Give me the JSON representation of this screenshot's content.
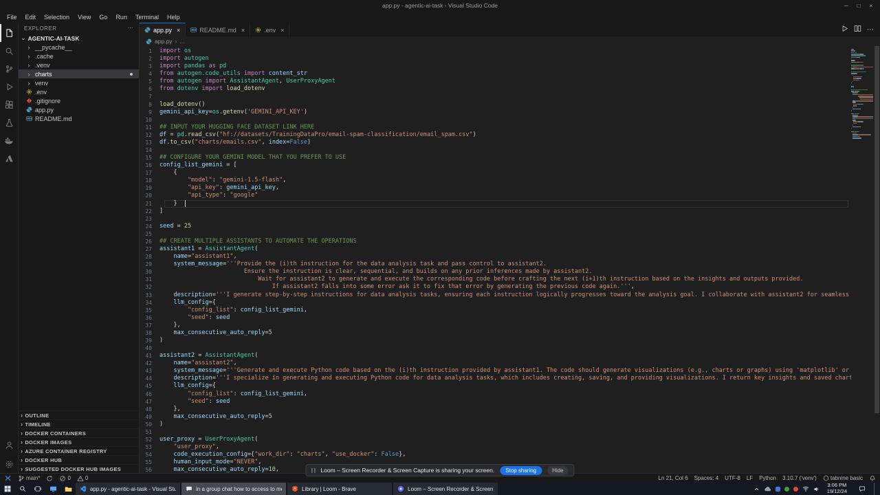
{
  "window": {
    "title": "app.py - agentic-ai-task - Visual Studio Code",
    "controls": [
      {
        "name": "minimize-button",
        "icon": "minimize-icon"
      },
      {
        "name": "maximize-button",
        "icon": "maximize-icon"
      },
      {
        "name": "close-button",
        "icon": "close-icon"
      }
    ]
  },
  "menubar": {
    "items": [
      "File",
      "Edit",
      "Selection",
      "View",
      "Go",
      "Run",
      "Terminal",
      "Help"
    ]
  },
  "activity_bar": {
    "top": [
      {
        "icon": "explorer-icon",
        "active": true
      },
      {
        "icon": "search-icon",
        "active": false
      },
      {
        "icon": "source-control-icon",
        "active": false
      },
      {
        "icon": "run-debug-icon",
        "active": false
      },
      {
        "icon": "extensions-icon",
        "active": false
      },
      {
        "icon": "testing-icon",
        "active": false
      },
      {
        "icon": "docker-icon",
        "active": false
      },
      {
        "icon": "azure-icon",
        "active": false
      }
    ],
    "bottom": [
      {
        "icon": "account-icon",
        "active": false
      },
      {
        "icon": "settings-icon",
        "active": false
      }
    ]
  },
  "explorer": {
    "header": "EXPLORER",
    "root": "AGENTIC-AI-TASK",
    "files": [
      {
        "label": "__pycache__",
        "kind": "folder"
      },
      {
        "label": ".cache",
        "kind": "folder"
      },
      {
        "label": ".venv",
        "kind": "folder"
      },
      {
        "label": "charts",
        "kind": "folder",
        "selected": true,
        "badge": true
      },
      {
        "label": "venv",
        "kind": "folder"
      },
      {
        "label": ".env",
        "kind": "file",
        "icon": "gear-file-icon"
      },
      {
        "label": ".gitignore",
        "kind": "file",
        "icon": "git-file-icon"
      },
      {
        "label": "app.py",
        "kind": "file",
        "icon": "python-file-icon"
      },
      {
        "label": "README.md",
        "kind": "file",
        "icon": "markdown-file-icon"
      }
    ],
    "sections": [
      "OUTLINE",
      "TIMELINE",
      "DOCKER CONTAINERS",
      "DOCKER IMAGES",
      "AZURE CONTAINER REGISTRY",
      "DOCKER HUB",
      "SUGGESTED DOCKER HUB IMAGES"
    ]
  },
  "editor_tabs": [
    {
      "label": "app.py",
      "icon": "python-file-icon",
      "active": true
    },
    {
      "label": "README.md",
      "icon": "markdown-file-icon",
      "active": false
    },
    {
      "label": ".env",
      "icon": "gear-file-icon",
      "active": false
    }
  ],
  "editor_actions": [
    {
      "icon": "run-icon"
    },
    {
      "icon": "split-editor-icon"
    },
    {
      "icon": "more-actions-icon"
    }
  ],
  "breadcrumb": {
    "file": "app.py",
    "symbol": "..."
  },
  "editor": {
    "cursor": {
      "line": 21,
      "col": 6
    },
    "lines": [
      [
        [
          "kw",
          "import"
        ],
        [
          "cls",
          " os"
        ]
      ],
      [
        [
          "kw",
          "import"
        ],
        [
          "cls",
          " autogen"
        ]
      ],
      [
        [
          "kw",
          "import"
        ],
        [
          "cls",
          " pandas"
        ],
        [
          "kw",
          " as"
        ],
        [
          "cls",
          " pd"
        ]
      ],
      [
        [
          "kw",
          "from"
        ],
        [
          "cls",
          " autogen.code_utils"
        ],
        [
          "kw",
          " import"
        ],
        [
          "var",
          " content_str"
        ]
      ],
      [
        [
          "kw",
          "from"
        ],
        [
          "cls",
          " autogen"
        ],
        [
          "kw",
          " import"
        ],
        [
          "cls",
          " AssistantAgent"
        ],
        [
          "txt",
          ","
        ],
        [
          "cls",
          " UserProxyAgent"
        ]
      ],
      [
        [
          "kw",
          "from"
        ],
        [
          "cls",
          " dotenv"
        ],
        [
          "kw",
          " import"
        ],
        [
          "fn",
          " load_dotenv"
        ]
      ],
      [],
      [
        [
          "fn",
          "load_dotenv"
        ],
        [
          "txt",
          "()"
        ]
      ],
      [
        [
          "var",
          "gemini_api_key"
        ],
        [
          "txt",
          "="
        ],
        [
          "cls",
          "os"
        ],
        [
          "txt",
          "."
        ],
        [
          "fn",
          "getenv"
        ],
        [
          "txt",
          "("
        ],
        [
          "str",
          "'GEMINI_API_KEY'"
        ],
        [
          "txt",
          ")"
        ]
      ],
      [],
      [
        [
          "com",
          "## INPUT YOUR HUGGING FACE DATASET LINK HERE"
        ]
      ],
      [
        [
          "var",
          "df"
        ],
        [
          "txt",
          " = "
        ],
        [
          "cls",
          "pd"
        ],
        [
          "txt",
          "."
        ],
        [
          "fn",
          "read_csv"
        ],
        [
          "txt",
          "("
        ],
        [
          "str",
          "\"hf://datasets/TrainingDataPro/email-spam-classification/email_spam.csv\""
        ],
        [
          "txt",
          ")"
        ]
      ],
      [
        [
          "var",
          "df"
        ],
        [
          "txt",
          "."
        ],
        [
          "fn",
          "to_csv"
        ],
        [
          "txt",
          "("
        ],
        [
          "str",
          "\"charts/emails.csv\""
        ],
        [
          "txt",
          ", "
        ],
        [
          "prm",
          "index"
        ],
        [
          "txt",
          "="
        ],
        [
          "const",
          "False"
        ],
        [
          "txt",
          ")"
        ]
      ],
      [],
      [
        [
          "com",
          "## CONFIGURE YOUR GEMINI MODEL THAT YOU PREFER TO USE"
        ]
      ],
      [
        [
          "var",
          "config_list_gemini"
        ],
        [
          "txt",
          " = ["
        ]
      ],
      [
        [
          "txt",
          "    {"
        ]
      ],
      [
        [
          "str",
          "        \"model\""
        ],
        [
          "txt",
          ": "
        ],
        [
          "str",
          "\"gemini-1.5-flash\""
        ],
        [
          "txt",
          ","
        ]
      ],
      [
        [
          "str",
          "        \"api_key\""
        ],
        [
          "txt",
          ": "
        ],
        [
          "var",
          "gemini_api_key"
        ],
        [
          "txt",
          ","
        ]
      ],
      [
        [
          "str",
          "        \"api_type\""
        ],
        [
          "txt",
          ": "
        ],
        [
          "str",
          "\"google\""
        ]
      ],
      [
        [
          "txt",
          "    }"
        ]
      ],
      [
        [
          "txt",
          "]"
        ]
      ],
      [],
      [
        [
          "var",
          "seed"
        ],
        [
          "txt",
          " = "
        ],
        [
          "num",
          "25"
        ]
      ],
      [],
      [
        [
          "com",
          "## CREATE MULTIPLE ASSISTANTS TO AUTOMATE THE OPERATIONS"
        ]
      ],
      [
        [
          "var",
          "assistant1"
        ],
        [
          "txt",
          " = "
        ],
        [
          "cls",
          "AssistantAgent"
        ],
        [
          "txt",
          "("
        ]
      ],
      [
        [
          "prm",
          "    name"
        ],
        [
          "txt",
          "="
        ],
        [
          "str",
          "\"assistant1\""
        ],
        [
          "txt",
          ","
        ]
      ],
      [
        [
          "prm",
          "    system_message"
        ],
        [
          "txt",
          "="
        ],
        [
          "str",
          "'''Provide the (i)th instruction for the data analysis task and pass control to assistant2."
        ]
      ],
      [
        [
          "str",
          "                        Ensure the instruction is clear, sequential, and builds on any prior inferences made by assistant2."
        ]
      ],
      [
        [
          "str",
          "                            Wait for assistant2 to generate and execute the corresponding code before crafting the next (i+1)th instruction based on the insights and outputs provided."
        ]
      ],
      [
        [
          "str",
          "                                If assistant2 falls into some error ask it to fix that error by generating the previous code again.'''"
        ],
        [
          "txt",
          ","
        ]
      ],
      [
        [
          "prm",
          "    description"
        ],
        [
          "txt",
          "="
        ],
        [
          "str",
          "'''I generate step-by-step instructions for data analysis tasks, ensuring each instruction logically progresses toward the analysis goal. I collaborate with assistant2 for seamless task execution.'''"
        ],
        [
          "txt",
          ","
        ]
      ],
      [
        [
          "prm",
          "    llm_config"
        ],
        [
          "txt",
          "={"
        ]
      ],
      [
        [
          "str",
          "        \"config_list\""
        ],
        [
          "txt",
          ": "
        ],
        [
          "var",
          "config_list_gemini"
        ],
        [
          "txt",
          ","
        ]
      ],
      [
        [
          "str",
          "        \"seed\""
        ],
        [
          "txt",
          ": "
        ],
        [
          "var",
          "seed"
        ]
      ],
      [
        [
          "txt",
          "    },"
        ]
      ],
      [
        [
          "prm",
          "    max_consecutive_auto_reply"
        ],
        [
          "txt",
          "="
        ],
        [
          "num",
          "5"
        ]
      ],
      [
        [
          "txt",
          ")"
        ]
      ],
      [],
      [
        [
          "var",
          "assistant2"
        ],
        [
          "txt",
          " = "
        ],
        [
          "cls",
          "AssistantAgent"
        ],
        [
          "txt",
          "("
        ]
      ],
      [
        [
          "prm",
          "    name"
        ],
        [
          "txt",
          "="
        ],
        [
          "str",
          "\"assistant2\""
        ],
        [
          "txt",
          ","
        ]
      ],
      [
        [
          "prm",
          "    system_message"
        ],
        [
          "txt",
          "="
        ],
        [
          "str",
          "'''Generate and execute Python code based on the (i)th instruction provided by assistant1. The code should generate visualizations (e.g., charts or graphs) using 'matplotlib' or other libraries.'''"
        ],
        [
          "txt",
          ","
        ]
      ],
      [
        [
          "prm",
          "    description"
        ],
        [
          "txt",
          "="
        ],
        [
          "str",
          "'''I specialize in generating and executing Python code for data analysis tasks, which includes creating, saving, and providing visualizations. I return key insights and saved chart file paths.'''"
        ],
        [
          "txt",
          ","
        ]
      ],
      [
        [
          "prm",
          "    llm_config"
        ],
        [
          "txt",
          "={"
        ]
      ],
      [
        [
          "str",
          "        \"config_list\""
        ],
        [
          "txt",
          ": "
        ],
        [
          "var",
          "config_list_gemini"
        ],
        [
          "txt",
          ","
        ]
      ],
      [
        [
          "str",
          "        \"seed\""
        ],
        [
          "txt",
          ": "
        ],
        [
          "var",
          "seed"
        ]
      ],
      [
        [
          "txt",
          "    },"
        ]
      ],
      [
        [
          "prm",
          "    max_consecutive_auto_reply"
        ],
        [
          "txt",
          "="
        ],
        [
          "num",
          "5"
        ]
      ],
      [
        [
          "txt",
          ")"
        ]
      ],
      [],
      [
        [
          "var",
          "user_proxy"
        ],
        [
          "txt",
          " = "
        ],
        [
          "cls",
          "UserProxyAgent"
        ],
        [
          "txt",
          "("
        ]
      ],
      [
        [
          "str",
          "    \"user_proxy\""
        ],
        [
          "txt",
          ","
        ]
      ],
      [
        [
          "prm",
          "    code_execution_config"
        ],
        [
          "txt",
          "={"
        ],
        [
          "str",
          "\"work_dir\""
        ],
        [
          "txt",
          ": "
        ],
        [
          "str",
          "\"charts\""
        ],
        [
          "txt",
          ", "
        ],
        [
          "str",
          "\"use_docker\""
        ],
        [
          "txt",
          ": "
        ],
        [
          "const",
          "False"
        ],
        [
          "txt",
          "},"
        ]
      ],
      [
        [
          "prm",
          "    human_input_mode"
        ],
        [
          "txt",
          "="
        ],
        [
          "str",
          "\"NEVER\""
        ],
        [
          "txt",
          ","
        ]
      ],
      [
        [
          "prm",
          "    max_consecutive_auto_reply"
        ],
        [
          "txt",
          "="
        ],
        [
          "num",
          "10"
        ],
        [
          "txt",
          ","
        ]
      ]
    ]
  },
  "sharing_toast": {
    "text": "Loom – Screen Recorder & Screen Capture is sharing your screen.",
    "stop_label": "Stop sharing",
    "hide_label": "Hide"
  },
  "status_bar": {
    "left": [
      {
        "icon": "remote-icon",
        "label": "",
        "name": "remote-indicator"
      },
      {
        "icon": "branch-icon",
        "label": "main*",
        "name": "git-branch"
      },
      {
        "icon": "sync-icon",
        "label": "",
        "name": "git-sync"
      },
      {
        "icon": "errors-icon",
        "label": "0",
        "name": "errors-count"
      },
      {
        "icon": "warnings-icon",
        "label": "0",
        "name": "warnings-count"
      }
    ],
    "right": [
      {
        "label": "Ln 21, Col 6",
        "name": "cursor-position"
      },
      {
        "label": "Spaces: 4",
        "name": "indentation"
      },
      {
        "label": "UTF-8",
        "name": "encoding"
      },
      {
        "label": "LF",
        "name": "eol"
      },
      {
        "label": "Python",
        "name": "language-mode"
      },
      {
        "label": "3.10.7 ('venv')",
        "name": "python-interpreter"
      },
      {
        "icon": "tabnine-icon",
        "label": "tabnine basic",
        "name": "tabnine"
      },
      {
        "icon": "bell-icon",
        "label": "",
        "name": "notifications-bell"
      }
    ]
  },
  "taskbar": {
    "start": [
      {
        "icon": "windows-start-icon",
        "name": "start-button"
      },
      {
        "icon": "taskbar-search-icon",
        "name": "taskbar-search"
      },
      {
        "icon": "task-view-icon",
        "name": "task-view"
      },
      {
        "icon": "monitor-icon",
        "name": "pinned-this-pc"
      },
      {
        "icon": "file-explorer-icon",
        "name": "pinned-file-explorer"
      }
    ],
    "windows": [
      {
        "icon": "vscode-icon",
        "label": "app.py - agentic-ai-task - Visual Stud...",
        "active": false
      },
      {
        "icon": "chat-icon",
        "label": "in a group chat how to access to me...",
        "active": true
      },
      {
        "icon": "brave-icon",
        "label": "Library | Loom - Brave",
        "active": false
      },
      {
        "icon": "loom-icon",
        "label": "Loom – Screen Recorder & Screen C...",
        "active": false
      }
    ],
    "tray": [
      {
        "icon": "chevron-up-icon",
        "name": "tray-expand"
      },
      {
        "icon": "cloud-icon",
        "name": "tray-onedrive"
      },
      {
        "icon": "teams-dot-icon",
        "name": "tray-teams"
      },
      {
        "icon": "green-dot-icon",
        "name": "tray-app-green"
      },
      {
        "icon": "red-dot-icon",
        "name": "tray-app-red"
      },
      {
        "icon": "wifi-icon",
        "name": "tray-network"
      },
      {
        "icon": "speaker-icon",
        "name": "tray-volume"
      }
    ],
    "clock": {
      "time": "3:06 PM",
      "date": "19/12/24"
    }
  },
  "colors": {
    "accent": "#0078d4",
    "stop_button": "#1a73e8",
    "selection_bg": "#37373d",
    "editor_bg": "#1f1f1f",
    "chrome_bg": "#181818"
  }
}
